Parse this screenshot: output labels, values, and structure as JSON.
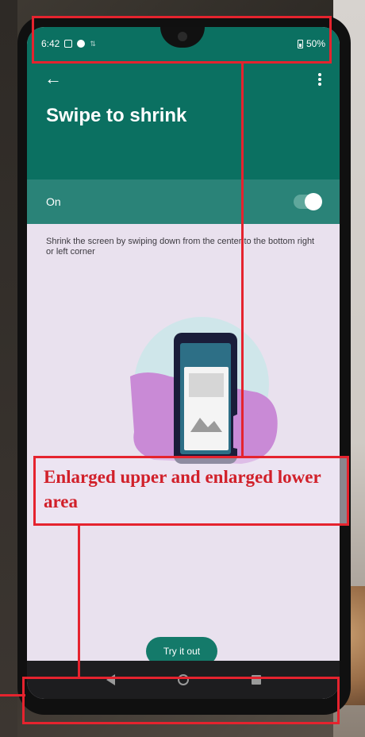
{
  "status_bar": {
    "time": "6:42",
    "battery": "50%"
  },
  "app_bar": {
    "title": "Swipe to shrink",
    "back_icon": "arrow-left-icon",
    "more_icon": "more-vertical-icon"
  },
  "toggle": {
    "label": "On",
    "state": "on"
  },
  "description": "Shrink the screen by swiping down from the center to the bottom right or left corner",
  "primary_button": {
    "label": "Try it out"
  },
  "nav_bar": {
    "icons": [
      "back-icon",
      "home-icon",
      "recents-icon"
    ]
  },
  "annotation": {
    "label": "Enlarged upper and enlarged lower area",
    "color": "#e5232e"
  },
  "colors": {
    "header": "#0b7061",
    "toggle_row": "#2a8378",
    "background": "#e9e1ee",
    "button": "#147a6a"
  }
}
